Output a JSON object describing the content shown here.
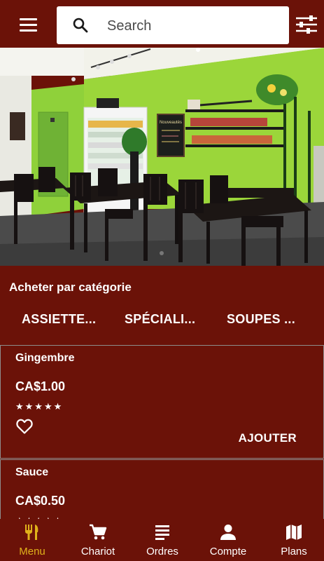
{
  "header": {
    "menu_icon": "hamburger-menu-icon",
    "search_placeholder": "Search",
    "search_icon": "search-icon",
    "filter_icon": "tune-sliders-icon"
  },
  "hero": {
    "image": "restaurant interior photo",
    "chalkboard_text": "Nouveautés"
  },
  "category": {
    "title": "Acheter par catégorie",
    "tabs": [
      "ASSIETTE...",
      "SPÉCIALI...",
      "SOUPES ..."
    ]
  },
  "products": [
    {
      "name": "Gingembre",
      "price": "CA$1.00",
      "stars": "★★★★★",
      "add_label": "AJOUTER"
    },
    {
      "name": "Sauce",
      "price": "CA$0.50",
      "stars": "★★★★★"
    }
  ],
  "nav": {
    "items": [
      {
        "label": "Menu",
        "icon": "fork-knife-icon",
        "active": true
      },
      {
        "label": "Chariot",
        "icon": "shopping-cart-icon"
      },
      {
        "label": "Ordres",
        "icon": "orders-list-icon"
      },
      {
        "label": "Compte",
        "icon": "account-person-icon"
      },
      {
        "label": "Plans",
        "icon": "map-icon"
      }
    ]
  },
  "colors": {
    "background": "#6b1208",
    "active_nav": "#e0b21b",
    "wall_green": "#9bd63a",
    "text": "#ffffff"
  }
}
